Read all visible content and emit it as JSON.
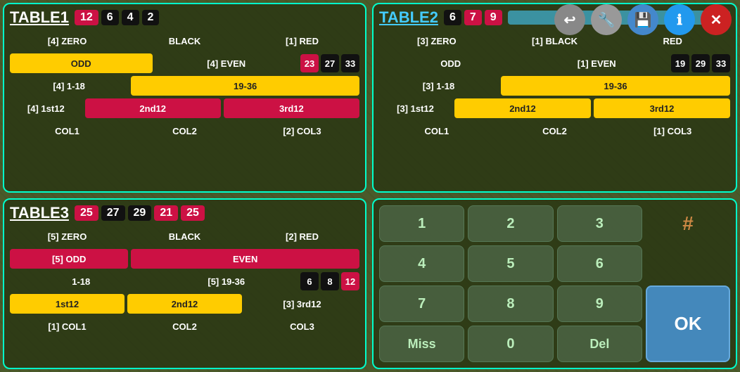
{
  "toolbar": {
    "back_label": "↩",
    "wrench_label": "🔧",
    "save_label": "💾",
    "info_label": "ℹ",
    "close_label": "✕"
  },
  "table1": {
    "title": "TABLE1",
    "header_badges": [
      {
        "value": "12",
        "color": "red"
      },
      {
        "value": "6",
        "color": "black"
      },
      {
        "value": "4",
        "color": "black"
      },
      {
        "value": "2",
        "color": "black"
      }
    ],
    "rows": [
      {
        "cols": [
          "[4] ZERO",
          "BLACK",
          "[1] RED"
        ]
      },
      {
        "cols": [
          "ODD",
          "[4] EVEN",
          ""
        ],
        "styles": [
          "yellow",
          "",
          ""
        ],
        "badges": [
          "23",
          "27",
          "33"
        ]
      },
      {
        "cols": [
          "[4] 1-18",
          "19-36",
          ""
        ],
        "styles": [
          "",
          "yellow",
          ""
        ]
      },
      {
        "cols": [
          "[4] 1st12",
          "2nd12",
          "3rd12"
        ],
        "styles": [
          "",
          "red",
          "red"
        ]
      },
      {
        "cols": [
          "COL1",
          "COL2",
          "[2] COL3"
        ]
      }
    ]
  },
  "table2": {
    "title": "TABLE2",
    "header_badges": [
      {
        "value": "6",
        "color": "black"
      },
      {
        "value": "7",
        "color": "red"
      },
      {
        "value": "9",
        "color": "red"
      }
    ],
    "rows": [
      {
        "cols": [
          "[3] ZERO",
          "[1] BLACK",
          "RED"
        ]
      },
      {
        "cols": [
          "ODD",
          "[1] EVEN",
          ""
        ],
        "badges": [
          "19",
          "29",
          "33"
        ]
      },
      {
        "cols": [
          "[3] 1-18",
          "19-36",
          ""
        ],
        "styles": [
          "",
          "yellow",
          ""
        ]
      },
      {
        "cols": [
          "[3] 1st12",
          "2nd12",
          "3rd12"
        ],
        "styles": [
          "",
          "yellow",
          "yellow"
        ]
      },
      {
        "cols": [
          "COL1",
          "COL2",
          "[1] COL3"
        ]
      }
    ]
  },
  "table3": {
    "title": "TABLE3",
    "header_badges": [
      {
        "value": "25",
        "color": "red"
      },
      {
        "value": "27",
        "color": "black"
      },
      {
        "value": "29",
        "color": "black"
      },
      {
        "value": "21",
        "color": "red"
      },
      {
        "value": "25",
        "color": "red"
      }
    ],
    "rows": [
      {
        "cols": [
          "[5] ZERO",
          "BLACK",
          "[2] RED"
        ]
      },
      {
        "cols": [
          "[5] ODD",
          "EVEN",
          ""
        ],
        "styles": [
          "red",
          "red",
          ""
        ]
      },
      {
        "cols": [
          "1-18",
          "[5] 19-36",
          ""
        ],
        "styles": [
          "",
          "",
          ""
        ],
        "badges": [
          "6",
          "8",
          "12"
        ]
      },
      {
        "cols": [
          "1st12",
          "2nd12",
          "[3] 3rd12"
        ],
        "styles": [
          "yellow",
          "yellow",
          ""
        ]
      },
      {
        "cols": [
          "[1] COL1",
          "COL2",
          "COL3"
        ]
      }
    ]
  },
  "numpad": {
    "buttons": [
      [
        "1",
        "2",
        "3"
      ],
      [
        "4",
        "5",
        "6"
      ],
      [
        "7",
        "8",
        "9"
      ],
      [
        "Miss",
        "0",
        "Del"
      ]
    ],
    "hash": "#",
    "ok": "OK"
  }
}
